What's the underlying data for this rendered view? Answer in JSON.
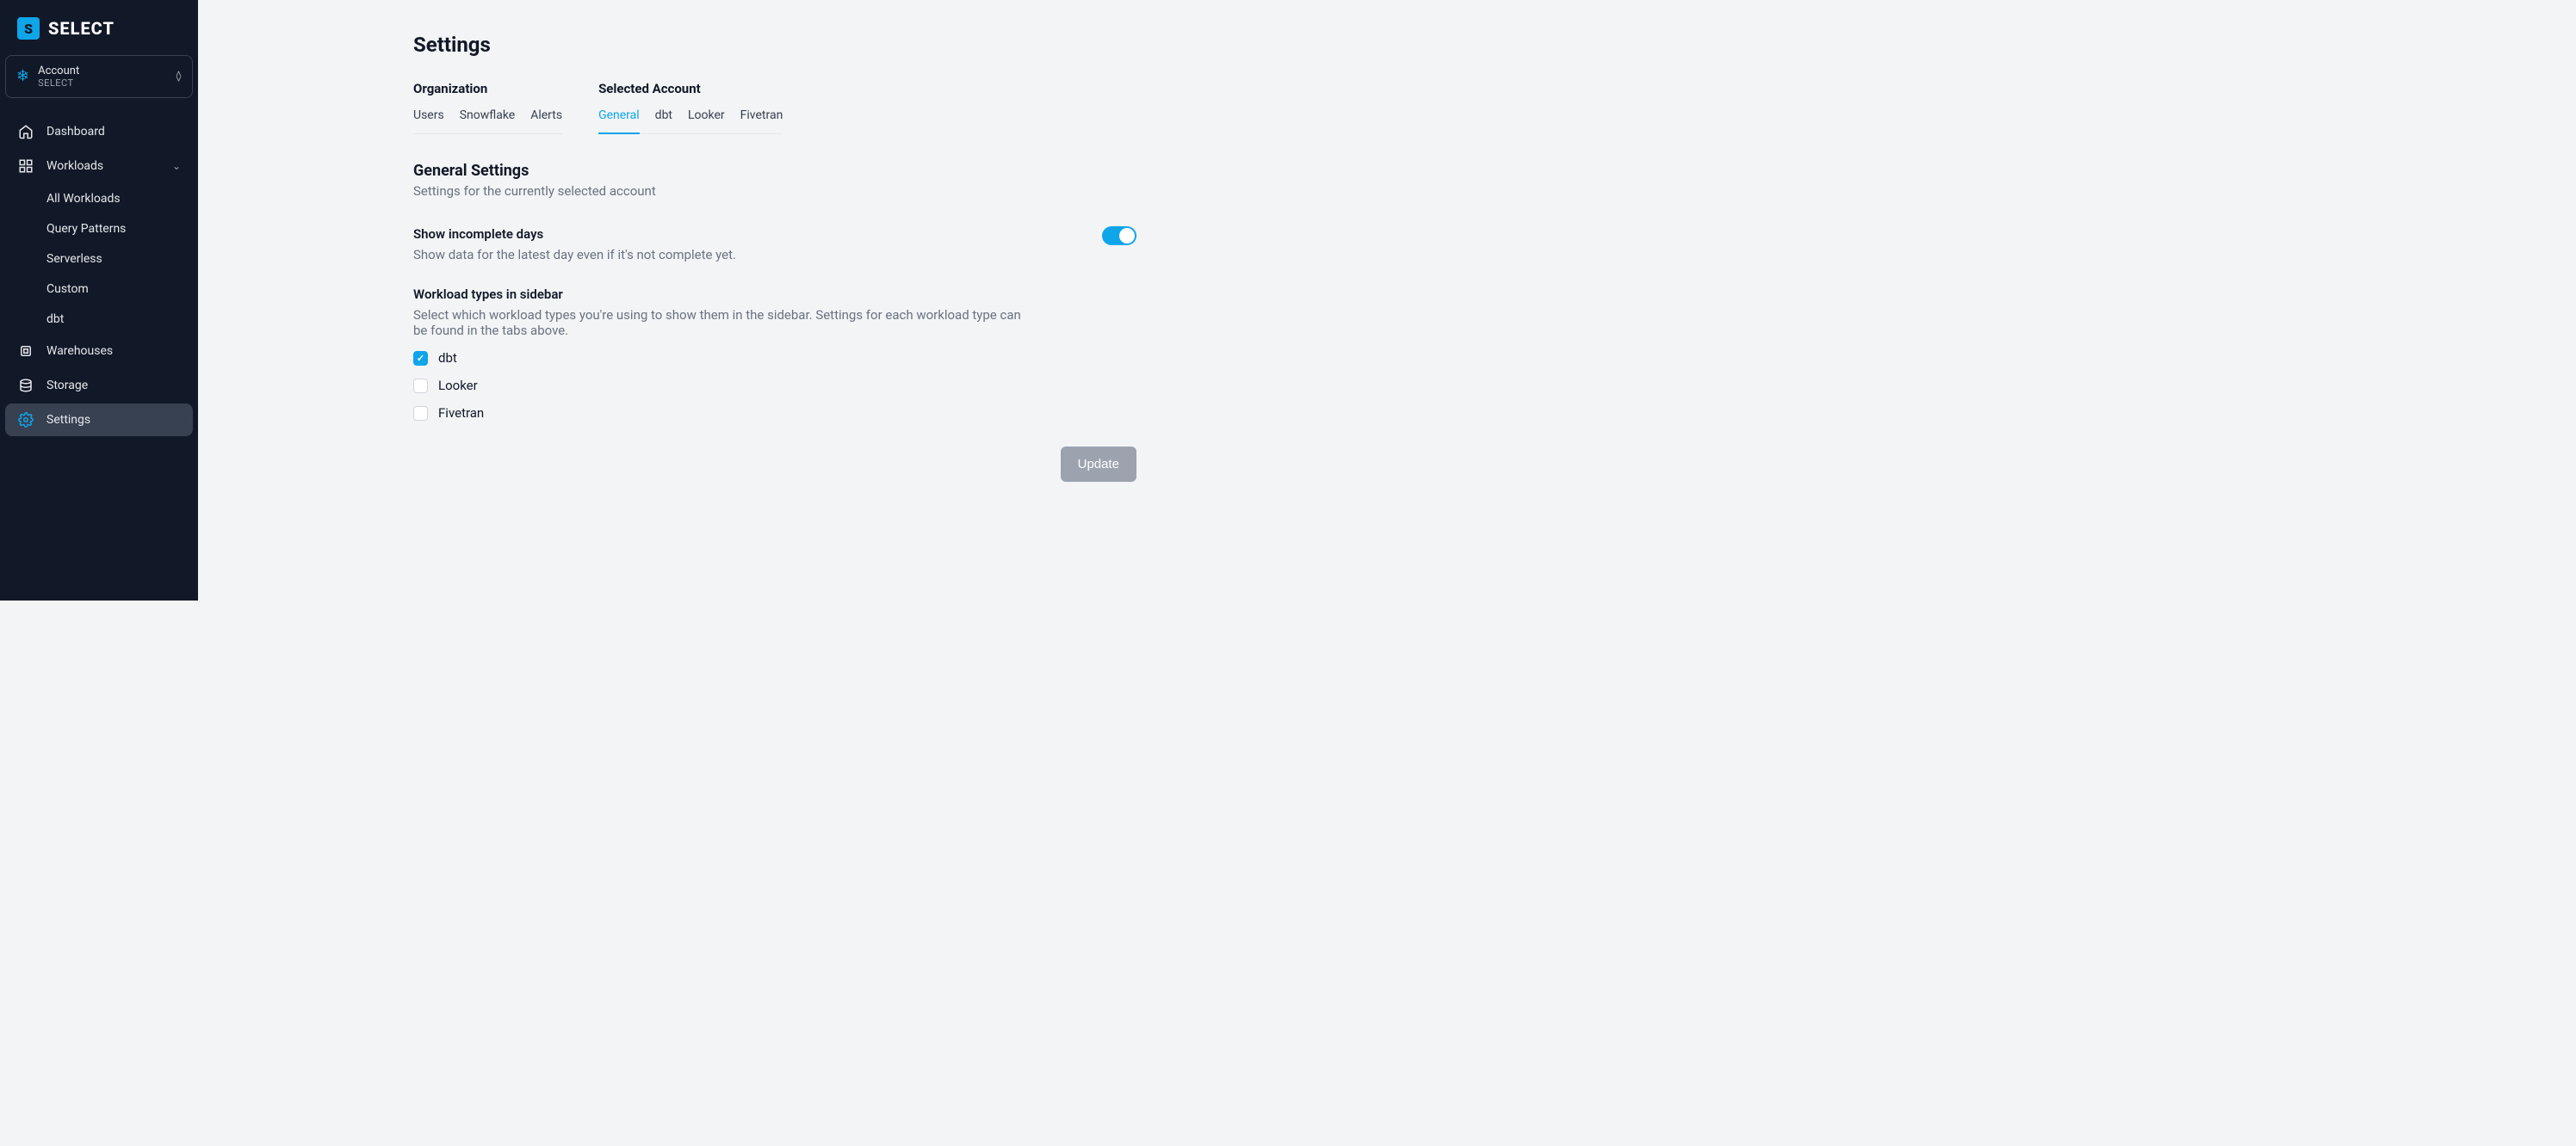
{
  "brand": {
    "name": "SELECT"
  },
  "sidebar": {
    "account": {
      "label": "Account",
      "value": "SELECT"
    },
    "items": [
      {
        "label": "Dashboard"
      },
      {
        "label": "Workloads",
        "expanded": true,
        "children": [
          {
            "label": "All Workloads"
          },
          {
            "label": "Query Patterns"
          },
          {
            "label": "Serverless"
          },
          {
            "label": "Custom"
          },
          {
            "label": "dbt"
          }
        ]
      },
      {
        "label": "Warehouses"
      },
      {
        "label": "Storage"
      },
      {
        "label": "Settings",
        "active": true
      }
    ]
  },
  "page": {
    "title": "Settings",
    "tab_groups": {
      "org": {
        "title": "Organization",
        "tabs": [
          "Users",
          "Snowflake",
          "Alerts"
        ]
      },
      "account": {
        "title": "Selected Account",
        "tabs": [
          "General",
          "dbt",
          "Looker",
          "Fivetran"
        ],
        "active": "General"
      }
    },
    "section": {
      "title": "General Settings",
      "desc": "Settings for the currently selected account"
    },
    "settings": {
      "incomplete_days": {
        "label": "Show incomplete days",
        "hint": "Show data for the latest day even if it's not complete yet.",
        "enabled": true
      },
      "workload_types": {
        "label": "Workload types in sidebar",
        "hint": "Select which workload types you're using to show them in the sidebar. Settings for each workload type can be found in the tabs above.",
        "options": [
          {
            "label": "dbt",
            "checked": true
          },
          {
            "label": "Looker",
            "checked": false
          },
          {
            "label": "Fivetran",
            "checked": false
          }
        ]
      }
    },
    "buttons": {
      "update": "Update"
    }
  }
}
